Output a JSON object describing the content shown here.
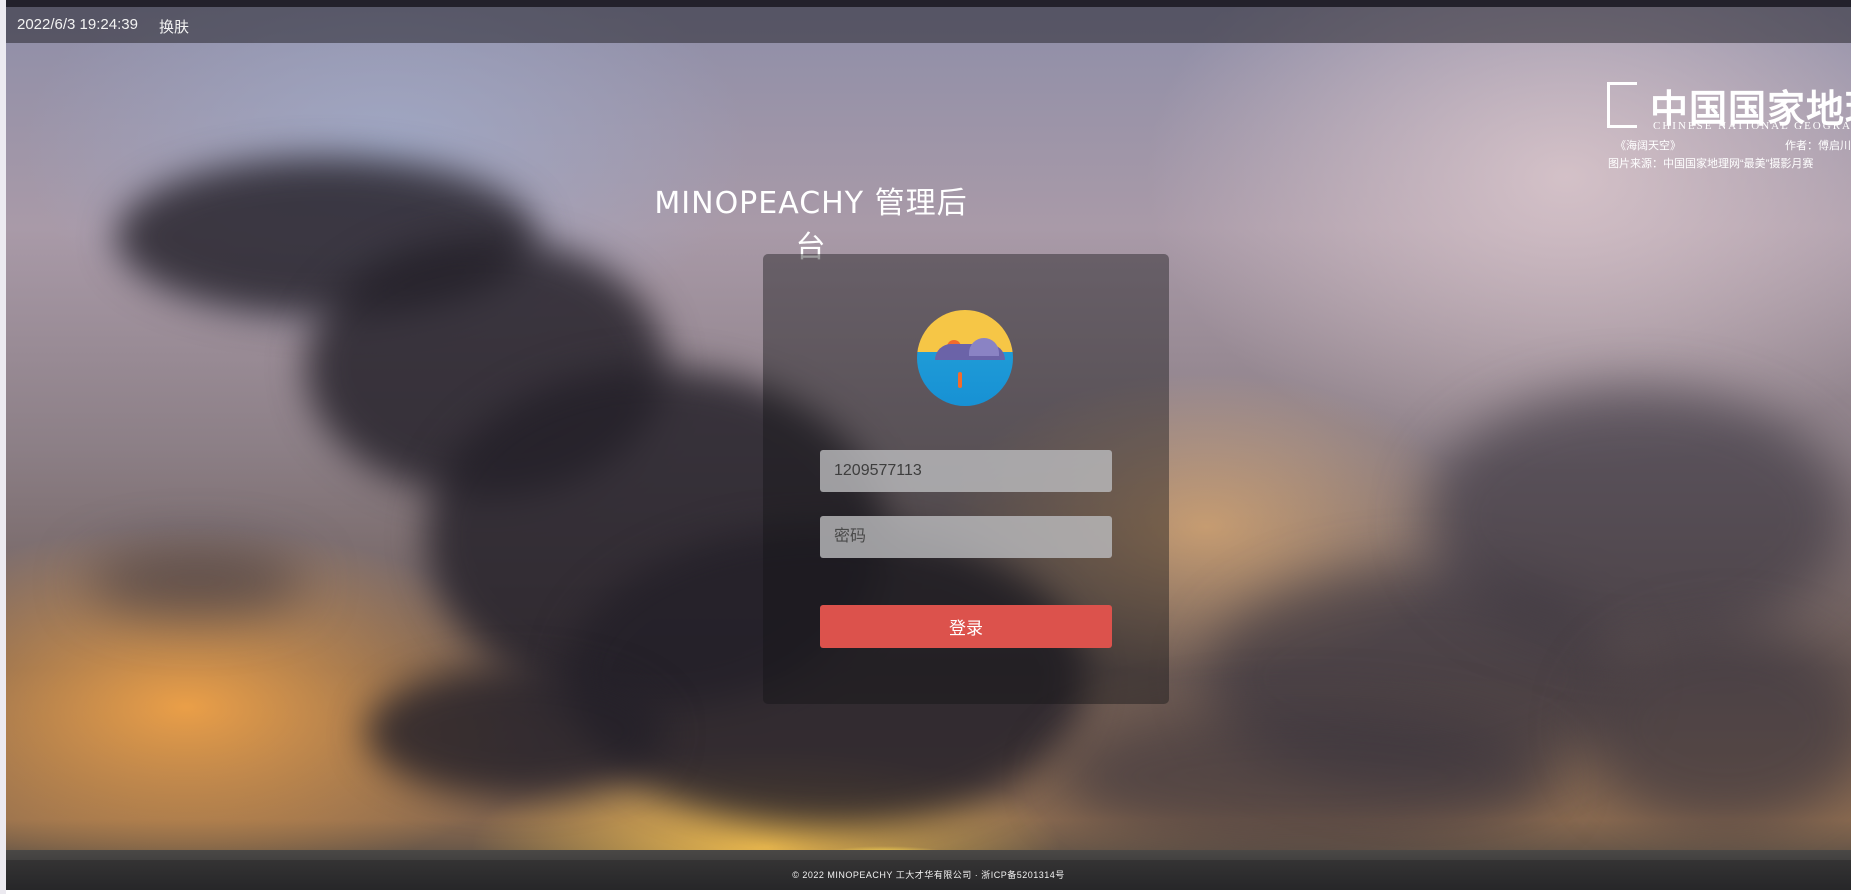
{
  "topbar": {
    "datetime": "2022/6/3 19:24:39",
    "skin_label": "换肤"
  },
  "watermark": {
    "title": "中国国家地理",
    "subtitle": "CHINESE NATIONAL GEOGRAPHI",
    "work": "《海阔天空》",
    "author": "作者：傅启川",
    "source": "图片来源：中国国家地理网“最美”摄影月赛"
  },
  "login": {
    "title": "MINOPEACHY 管理后台",
    "username_value": "1209577113",
    "password_placeholder": "密码",
    "submit_label": "登录",
    "button_color": "#dc524c"
  },
  "footer": {
    "text": "© 2022 MINOPEACHY 工大才华有限公司 · 浙ICP备5201314号"
  }
}
